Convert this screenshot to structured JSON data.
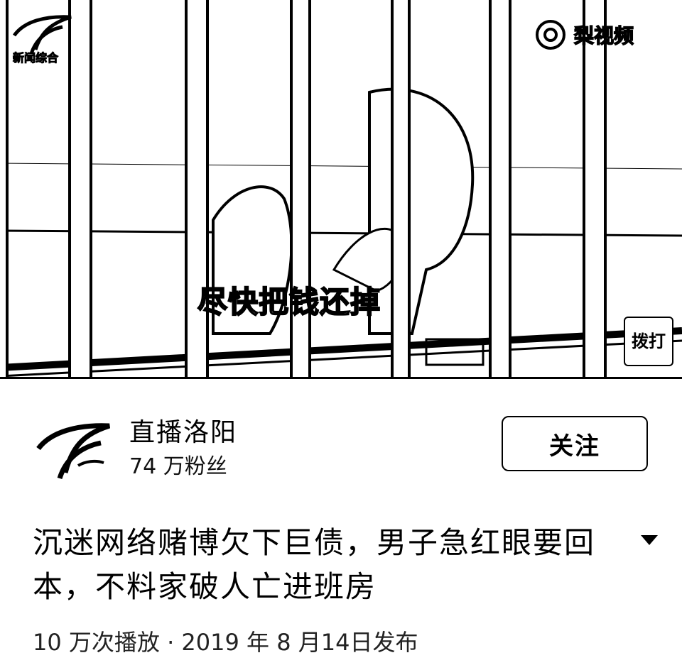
{
  "video": {
    "subtitle": "尽快把钱还掉",
    "watermark_left": "新闻综合",
    "watermark_right": "梨视频",
    "corner_badge": "拨打"
  },
  "channel": {
    "name": "直播洛阳",
    "fans": "74 万粉丝",
    "follow_label": "关注"
  },
  "post": {
    "title": "沉迷网络赌博欠下巨债，男子急红眼要回本，不料家破人亡进班房",
    "meta": "10 万次播放 · 2019 年 8 月14日发布"
  },
  "icons": {
    "expand": "chevron-down-icon",
    "channel_logo": "channel-logo-icon",
    "watermark_logo": "pear-video-logo-icon"
  }
}
